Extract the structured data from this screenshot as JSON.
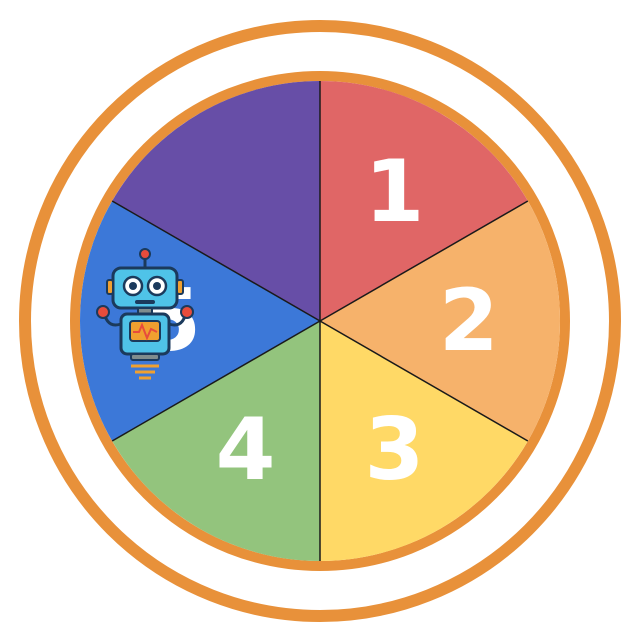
{
  "wheel": {
    "ring_color": "#E8913A",
    "outline_color": "#1a1a1a",
    "segments": [
      {
        "label": "1",
        "color": "#E06666"
      },
      {
        "label": "2",
        "color": "#F6B26B"
      },
      {
        "label": "3",
        "color": "#FFD966"
      },
      {
        "label": "4",
        "color": "#93C47D"
      },
      {
        "label": "5",
        "color": "#3C78D8"
      },
      {
        "label": "",
        "color": "#674EA7",
        "icon": "robot-icon"
      }
    ]
  }
}
